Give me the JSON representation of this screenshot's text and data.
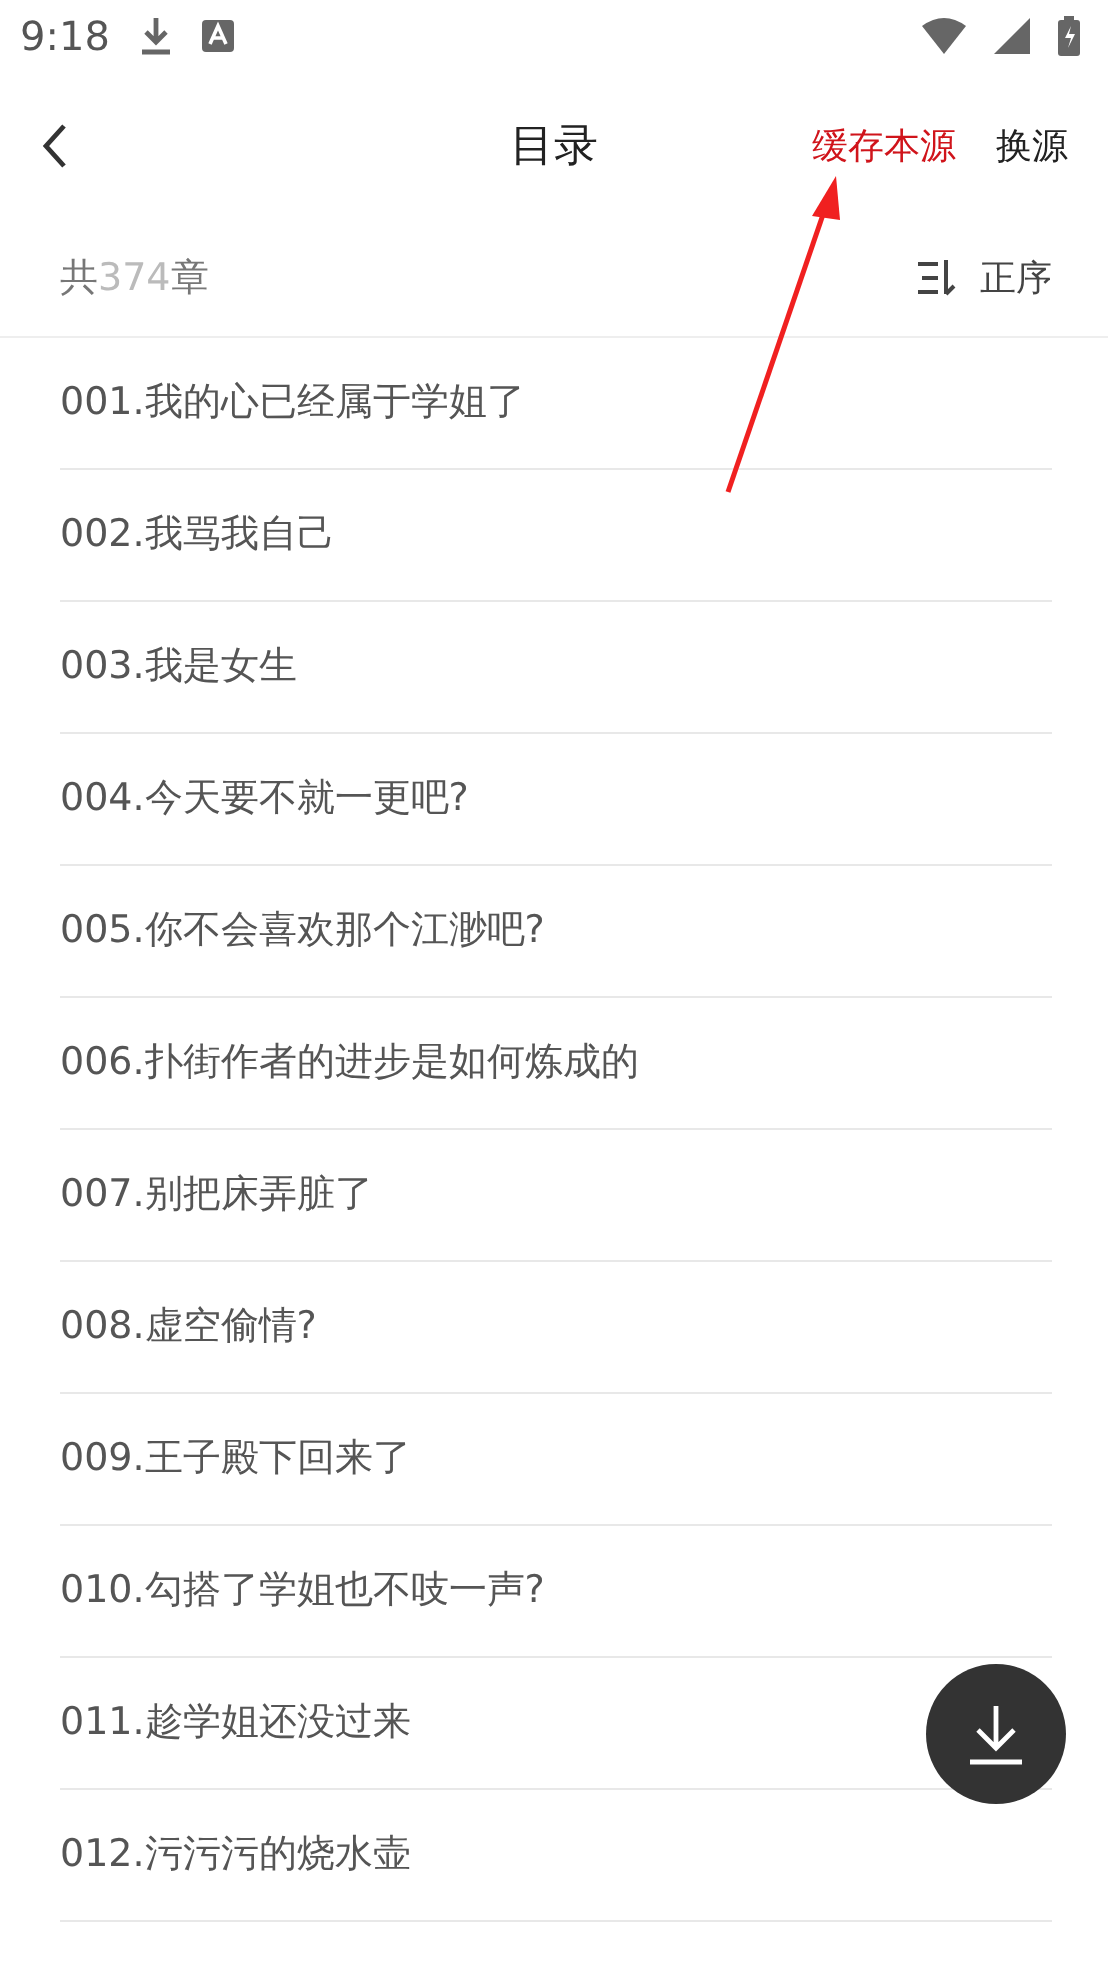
{
  "status_bar": {
    "time": "9:18"
  },
  "header": {
    "title": "目录",
    "actions": [
      {
        "label": "缓存本源",
        "highlighted": true
      },
      {
        "label": "换源",
        "highlighted": false
      }
    ]
  },
  "summary": {
    "prefix": "共",
    "count": "374",
    "suffix": "章",
    "sort_label": "正序"
  },
  "chapters": [
    {
      "title": "001.我的心已经属于学姐了"
    },
    {
      "title": "002.我骂我自己"
    },
    {
      "title": "003.我是女生"
    },
    {
      "title": "004.今天要不就一更吧?"
    },
    {
      "title": "005.你不会喜欢那个江渺吧?"
    },
    {
      "title": "006.扑街作者的进步是如何炼成的"
    },
    {
      "title": "007.别把床弄脏了"
    },
    {
      "title": "008.虚空偷情?"
    },
    {
      "title": "009.王子殿下回来了"
    },
    {
      "title": "010.勾搭了学姐也不吱一声?"
    },
    {
      "title": "011.趁学姐还没过来"
    },
    {
      "title": "012.污污污的烧水壶"
    }
  ]
}
